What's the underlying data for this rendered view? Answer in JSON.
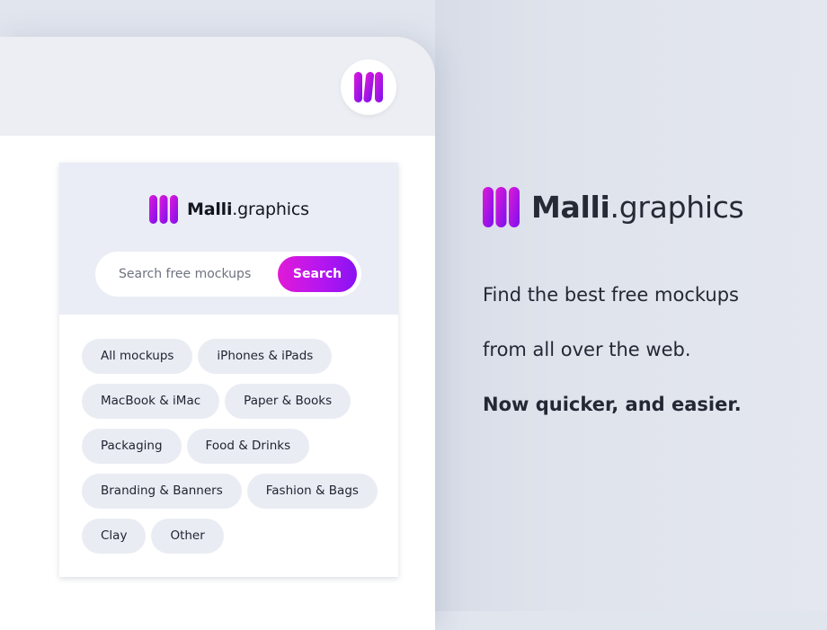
{
  "extension": {
    "icon": "malli-logo-icon"
  },
  "popup": {
    "brand": {
      "name_bold": "Malli",
      "name_rest": ".graphics",
      "icon": "malli-logo-icon"
    },
    "search": {
      "placeholder": "Search free mockups",
      "value": "",
      "button_label": "Search"
    },
    "categories": [
      "All mockups",
      "iPhones & iPads",
      "MacBook & iMac",
      "Paper & Books",
      "Packaging",
      "Food & Drinks",
      "Branding & Banners",
      "Fashion & Bags",
      "Clay",
      "Other"
    ]
  },
  "promo": {
    "brand": {
      "name_bold": "Malli",
      "name_rest": ".graphics"
    },
    "line1": "Find the best free mockups",
    "line2": "from all over the web.",
    "line3": "Now quicker, and easier."
  },
  "colors": {
    "accent_start": "#e11ad6",
    "accent_end": "#8a12f2",
    "background": "#e1e5ee",
    "chip": "#e9ecf3"
  }
}
